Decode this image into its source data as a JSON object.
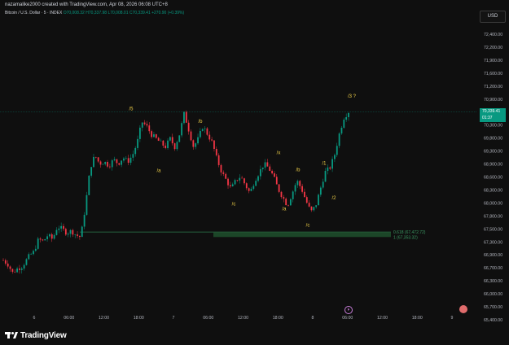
{
  "header": {
    "credit": "nazamalike2000 created with TradingView.com, Apr 08, 2026 06:08 UTC+8",
    "symbol": "Bitcoin / U.S. Dollar · 5 · INDEX",
    "ohlc": "O70,008.32 H70,337.98 L70,008.01 C70,339.41 +270.90 (+0.39%)",
    "currency": "USD"
  },
  "price_axis": {
    "labels": [
      "72,400.00",
      "72,200.00",
      "71,900.00",
      "71,600.00",
      "71,200.00",
      "70,900.00",
      "70,500.00",
      "70,300.00",
      "69,800.00",
      "69,300.00",
      "68,900.00",
      "68,600.00",
      "68,300.00",
      "68,000.00",
      "67,800.00",
      "67,500.00",
      "67,300.00",
      "66,900.00",
      "66,700.00",
      "66,300.00",
      "66,000.00",
      "65,700.00",
      "65,400.00"
    ]
  },
  "current_price": {
    "value": "70,339.41",
    "countdown": "01:37"
  },
  "time_axis": {
    "labels": [
      "6",
      "06:00",
      "12:00",
      "18:00",
      "7",
      "06:00",
      "12:00",
      "18:00",
      "8",
      "06:00",
      "12:00",
      "18:00",
      "9"
    ]
  },
  "wave_labels": [
    "/5",
    "/a",
    "/b",
    "/c",
    "/x",
    "/a",
    "/b",
    "/c",
    "/1",
    "/2",
    "/3 ?"
  ],
  "fib_labels": [
    "0.618 (67,472.72)",
    "1 (67,353.32)"
  ],
  "colors": {
    "up": "#089981",
    "down": "#f23645",
    "wave": "#f0d048",
    "zone": "#1e4d2b"
  },
  "branding": {
    "logo_text": "TradingView"
  },
  "chart_data": {
    "type": "candlestick",
    "title": "Bitcoin / U.S. Dollar · 5 · INDEX",
    "ylim": [
      65400,
      72500
    ],
    "x_labels": [
      "6",
      "06:00",
      "12:00",
      "18:00",
      "7",
      "06:00",
      "12:00",
      "18:00",
      "8",
      "06:00",
      "12:00",
      "18:00",
      "9"
    ],
    "close_path": [
      [
        0,
        66800
      ],
      [
        4,
        66700
      ],
      [
        8,
        66500
      ],
      [
        12,
        66600
      ],
      [
        16,
        66650
      ],
      [
        22,
        66900
      ],
      [
        26,
        67000
      ],
      [
        30,
        67300
      ],
      [
        34,
        67250
      ],
      [
        38,
        67400
      ],
      [
        42,
        67300
      ],
      [
        46,
        67600
      ],
      [
        50,
        67550
      ],
      [
        54,
        67450
      ],
      [
        58,
        67500
      ],
      [
        62,
        67400
      ],
      [
        66,
        67350
      ],
      [
        70,
        68100
      ],
      [
        74,
        69000
      ],
      [
        78,
        69300
      ],
      [
        82,
        69100
      ],
      [
        86,
        69150
      ],
      [
        90,
        69050
      ],
      [
        94,
        69200
      ],
      [
        98,
        69100
      ],
      [
        102,
        69250
      ],
      [
        106,
        69150
      ],
      [
        110,
        69300
      ],
      [
        114,
        69600
      ],
      [
        118,
        70100
      ],
      [
        122,
        70000
      ],
      [
        126,
        69800
      ],
      [
        130,
        69700
      ],
      [
        134,
        69600
      ],
      [
        138,
        69500
      ],
      [
        142,
        69700
      ],
      [
        146,
        69500
      ],
      [
        150,
        69800
      ],
      [
        154,
        70300
      ],
      [
        158,
        69900
      ],
      [
        162,
        69500
      ],
      [
        166,
        69700
      ],
      [
        170,
        70000
      ],
      [
        174,
        69800
      ],
      [
        178,
        69600
      ],
      [
        182,
        69200
      ],
      [
        186,
        68900
      ],
      [
        190,
        68700
      ],
      [
        194,
        68500
      ],
      [
        198,
        68700
      ],
      [
        202,
        68800
      ],
      [
        206,
        68600
      ],
      [
        210,
        68400
      ],
      [
        214,
        68700
      ],
      [
        218,
        68900
      ],
      [
        222,
        69100
      ],
      [
        226,
        69000
      ],
      [
        230,
        68800
      ],
      [
        234,
        68500
      ],
      [
        238,
        68300
      ],
      [
        242,
        68100
      ],
      [
        246,
        68400
      ],
      [
        250,
        68700
      ],
      [
        254,
        68500
      ],
      [
        258,
        68200
      ],
      [
        262,
        67950
      ],
      [
        266,
        68100
      ],
      [
        270,
        68500
      ],
      [
        274,
        68900
      ],
      [
        278,
        69000
      ],
      [
        282,
        69300
      ],
      [
        286,
        69800
      ],
      [
        290,
        70200
      ],
      [
        294,
        70339
      ]
    ],
    "wave_points": [
      {
        "label": "/5",
        "value": 70300
      },
      {
        "label": "/a",
        "value": 69100
      },
      {
        "label": "/b",
        "value": 70000
      },
      {
        "label": "/c",
        "value": 68300
      },
      {
        "label": "/x",
        "value": 69250
      },
      {
        "label": "/a",
        "value": 68200
      },
      {
        "label": "/b",
        "value": 68800
      },
      {
        "label": "/c",
        "value": 67800
      },
      {
        "label": "/1",
        "value": 69000
      },
      {
        "label": "/2",
        "value": 68450
      },
      {
        "label": "/3 ?",
        "value": 70600
      }
    ],
    "fib_levels": [
      {
        "label": "0.618",
        "value": 67472.72
      },
      {
        "label": "1",
        "value": 67353.32
      }
    ]
  }
}
